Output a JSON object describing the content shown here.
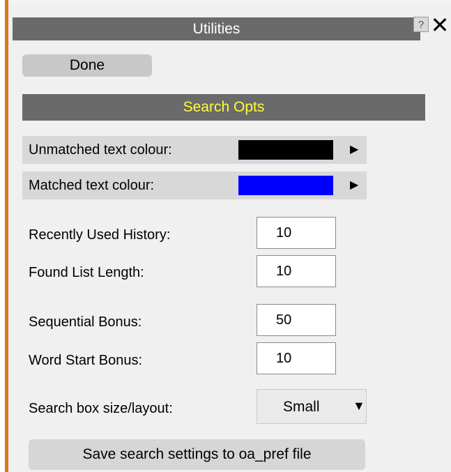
{
  "window": {
    "title": "Utilities",
    "help_label": "?",
    "close_label": "✕"
  },
  "toolbar": {
    "done_label": "Done"
  },
  "section": {
    "title": "Search Opts",
    "title_color": "#ffff33"
  },
  "colours": {
    "unmatched_label": "Unmatched text colour:",
    "unmatched_value": "#000000",
    "matched_label": "Matched text colour:",
    "matched_value": "#0000ff",
    "arrow_glyph": "▶"
  },
  "fields": {
    "recently_used_label": "Recently Used History:",
    "recently_used_value": "10",
    "found_list_label": "Found List Length:",
    "found_list_value": "10",
    "sequential_label": "Sequential Bonus:",
    "sequential_value": "50",
    "word_start_label": "Word Start Bonus:",
    "word_start_value": "10"
  },
  "layout_select": {
    "label": "Search box size/layout:",
    "value": "Small",
    "caret_glyph": "▼"
  },
  "save": {
    "label": "Save search settings to oa_pref file"
  }
}
